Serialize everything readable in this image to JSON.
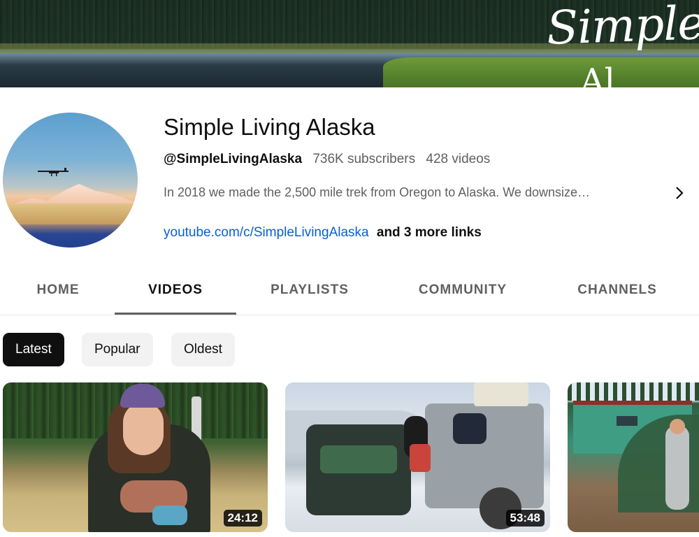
{
  "banner": {
    "brand_text": "Simple",
    "brand_text_2": "Al"
  },
  "channel": {
    "name": "Simple Living Alaska",
    "handle": "@SimpleLivingAlaska",
    "subscribers": "736K subscribers",
    "videos_count": "428 videos",
    "description": "In 2018 we made the 2,500 mile trek from Oregon to Alaska. We downsize…",
    "link": "youtube.com/c/SimpleLivingAlaska",
    "more_links": "and 3 more links"
  },
  "tabs": [
    {
      "label": "HOME",
      "active": false
    },
    {
      "label": "VIDEOS",
      "active": true
    },
    {
      "label": "PLAYLISTS",
      "active": false
    },
    {
      "label": "COMMUNITY",
      "active": false
    },
    {
      "label": "CHANNELS",
      "active": false
    }
  ],
  "chips": [
    {
      "label": "Latest",
      "active": true
    },
    {
      "label": "Popular",
      "active": false
    },
    {
      "label": "Oldest",
      "active": false
    }
  ],
  "videos": [
    {
      "duration": "24:12"
    },
    {
      "duration": "53:48"
    },
    {
      "duration": ""
    }
  ],
  "icons": {
    "description_expand": "chevron-right-icon",
    "avatar_plane": "airplane-icon"
  },
  "colors": {
    "link": "#065fd4",
    "chip_active_bg": "#0f0f0f",
    "chip_bg": "#f2f2f2",
    "text_secondary": "#606060"
  }
}
